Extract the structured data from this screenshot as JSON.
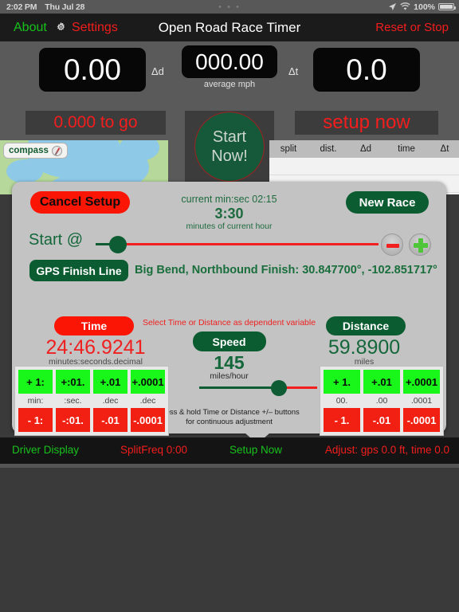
{
  "statusbar": {
    "time": "2:02 PM",
    "date": "Thu Jul 28",
    "dots": "• • •",
    "location_icon": "location-arrow-icon",
    "wifi_icon": "wifi-icon",
    "battery_pct": "100%",
    "battery_icon": "battery-full-icon"
  },
  "navbar": {
    "about": "About",
    "settings": "Settings",
    "settings_icon": "gear-icon",
    "title": "Open Road Race Timer",
    "reset": "Reset or Stop"
  },
  "readouts": {
    "delta_d_value": "0.00",
    "delta_d_label": "Δd",
    "average_value": "000.00",
    "average_label": "average mph",
    "delta_t_label": "Δt",
    "delta_t_value": "0.0"
  },
  "midband": {
    "to_go": "0.000 to go",
    "start_line1": "Start",
    "start_line2": "Now!",
    "setup_now_box": "setup now"
  },
  "map": {
    "compass_label": "compass",
    "compass_icon": "compass-icon"
  },
  "split_table": {
    "headers": [
      "split",
      "dist.",
      "Δd",
      "time",
      "Δt"
    ],
    "rows": []
  },
  "popover": {
    "cancel_setup": "Cancel Setup",
    "new_race": "New Race",
    "current_minsec": "current min:sec 02:15",
    "current_big": "3:30",
    "current_sub": "minutes of current hour",
    "start_at_label": "Start @",
    "minus_icon": "minus-circle-icon",
    "plus_icon": "plus-circle-icon",
    "gps_button": "GPS Finish Line",
    "gps_text": "Big Bend, Northbound Finish: 30.847700°, -102.851717°",
    "select_hint": "Select Time or Distance as dependent variable",
    "time_button": "Time",
    "time_value": "24:46.9241",
    "time_sub": "minutes:seconds.decimal",
    "speed_button": "Speed",
    "speed_value": "145",
    "speed_sub": "miles/hour",
    "distance_button": "Distance",
    "distance_value": "59.8900",
    "distance_sub": "miles",
    "press_hold_line1": "press & hold Time or Distance +/– buttons",
    "press_hold_line2": "for continuous adjustment",
    "time_stepper": {
      "plus": [
        "+ 1:",
        "+:01.",
        "+.01",
        "+.0001"
      ],
      "labels": [
        "min:",
        ":sec.",
        ".dec",
        ".dec"
      ],
      "minus": [
        "- 1:",
        "-:01.",
        "-.01",
        "-.0001"
      ]
    },
    "distance_stepper": {
      "plus": [
        "+ 1.",
        "+.01",
        "+.0001"
      ],
      "labels": [
        "00.",
        ".00",
        ".0001"
      ],
      "minus": [
        "- 1.",
        "-.01",
        "-.0001"
      ]
    }
  },
  "toolbar": {
    "driver_display": "Driver Display",
    "split_freq": "SplitFreq 0:00",
    "setup_now": "Setup Now",
    "adjust": "Adjust: gps 0.0 ft, time 0.0"
  },
  "colors": {
    "green": "#18c21c",
    "red": "#f41d1d",
    "dark_green": "#0b5c30",
    "panel": "#c3c3c3",
    "stepper_plus": "#19f619",
    "stepper_minus": "#f22012"
  }
}
